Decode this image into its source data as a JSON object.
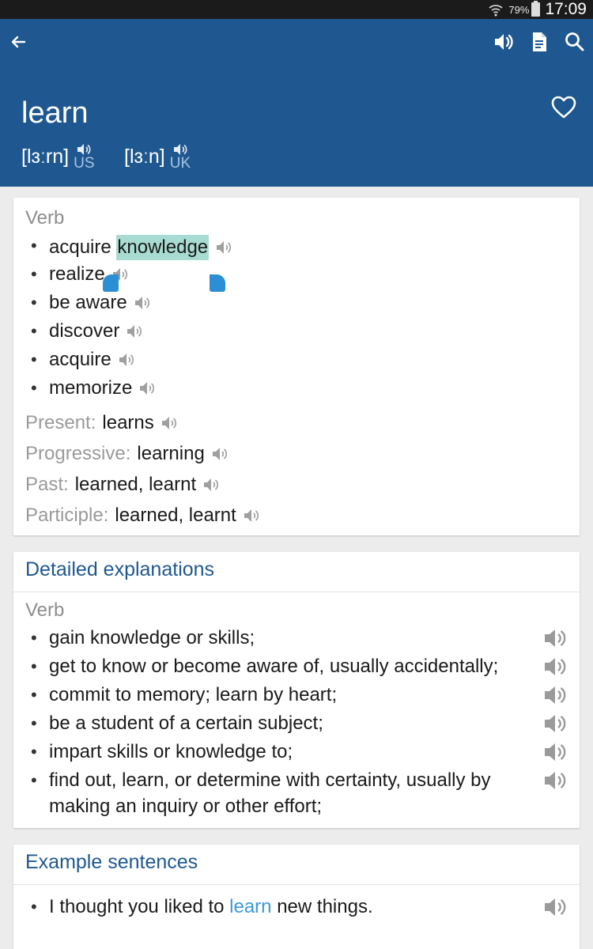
{
  "status_bar": {
    "battery": "79%",
    "time": "17:09"
  },
  "app_bar": {
    "word": "learn",
    "pronunciations": [
      {
        "ipa": "[lɜːrn]",
        "region": "US"
      },
      {
        "ipa": "[lɜːn]",
        "region": "UK"
      }
    ]
  },
  "verb_card": {
    "pos": "Verb",
    "synonyms": [
      {
        "prefix": "acquire ",
        "highlight": "knowledge"
      },
      {
        "prefix": "realize",
        "highlight": ""
      },
      {
        "prefix": "be aware",
        "highlight": ""
      },
      {
        "prefix": "discover",
        "highlight": ""
      },
      {
        "prefix": "acquire",
        "highlight": ""
      },
      {
        "prefix": "memorize",
        "highlight": ""
      }
    ],
    "forms": [
      {
        "label": "Present:",
        "value": "learns"
      },
      {
        "label": "Progressive:",
        "value": "learning"
      },
      {
        "label": "Past:",
        "value": "learned, learnt"
      },
      {
        "label": "Participle:",
        "value": "learned, learnt"
      }
    ]
  },
  "detailed_card": {
    "title": "Detailed explanations",
    "pos": "Verb",
    "items": [
      {
        "line1": "gain knowledge or skills;",
        "line2": ""
      },
      {
        "line1": "get to know or become aware of, usually accidentally;",
        "line2": ""
      },
      {
        "line1": "commit to memory; learn by heart;",
        "line2": ""
      },
      {
        "line1": "be a student of a certain subject;",
        "line2": ""
      },
      {
        "line1": "impart skills or knowledge to;",
        "line2": ""
      },
      {
        "line1": "find out, learn, or determine with certainty, usually by",
        "line2": "making an inquiry or other effort;"
      }
    ]
  },
  "examples_card": {
    "title": "Example sentences",
    "items": [
      {
        "before": "I thought you liked to ",
        "link": "learn",
        "after": " new things."
      }
    ]
  }
}
